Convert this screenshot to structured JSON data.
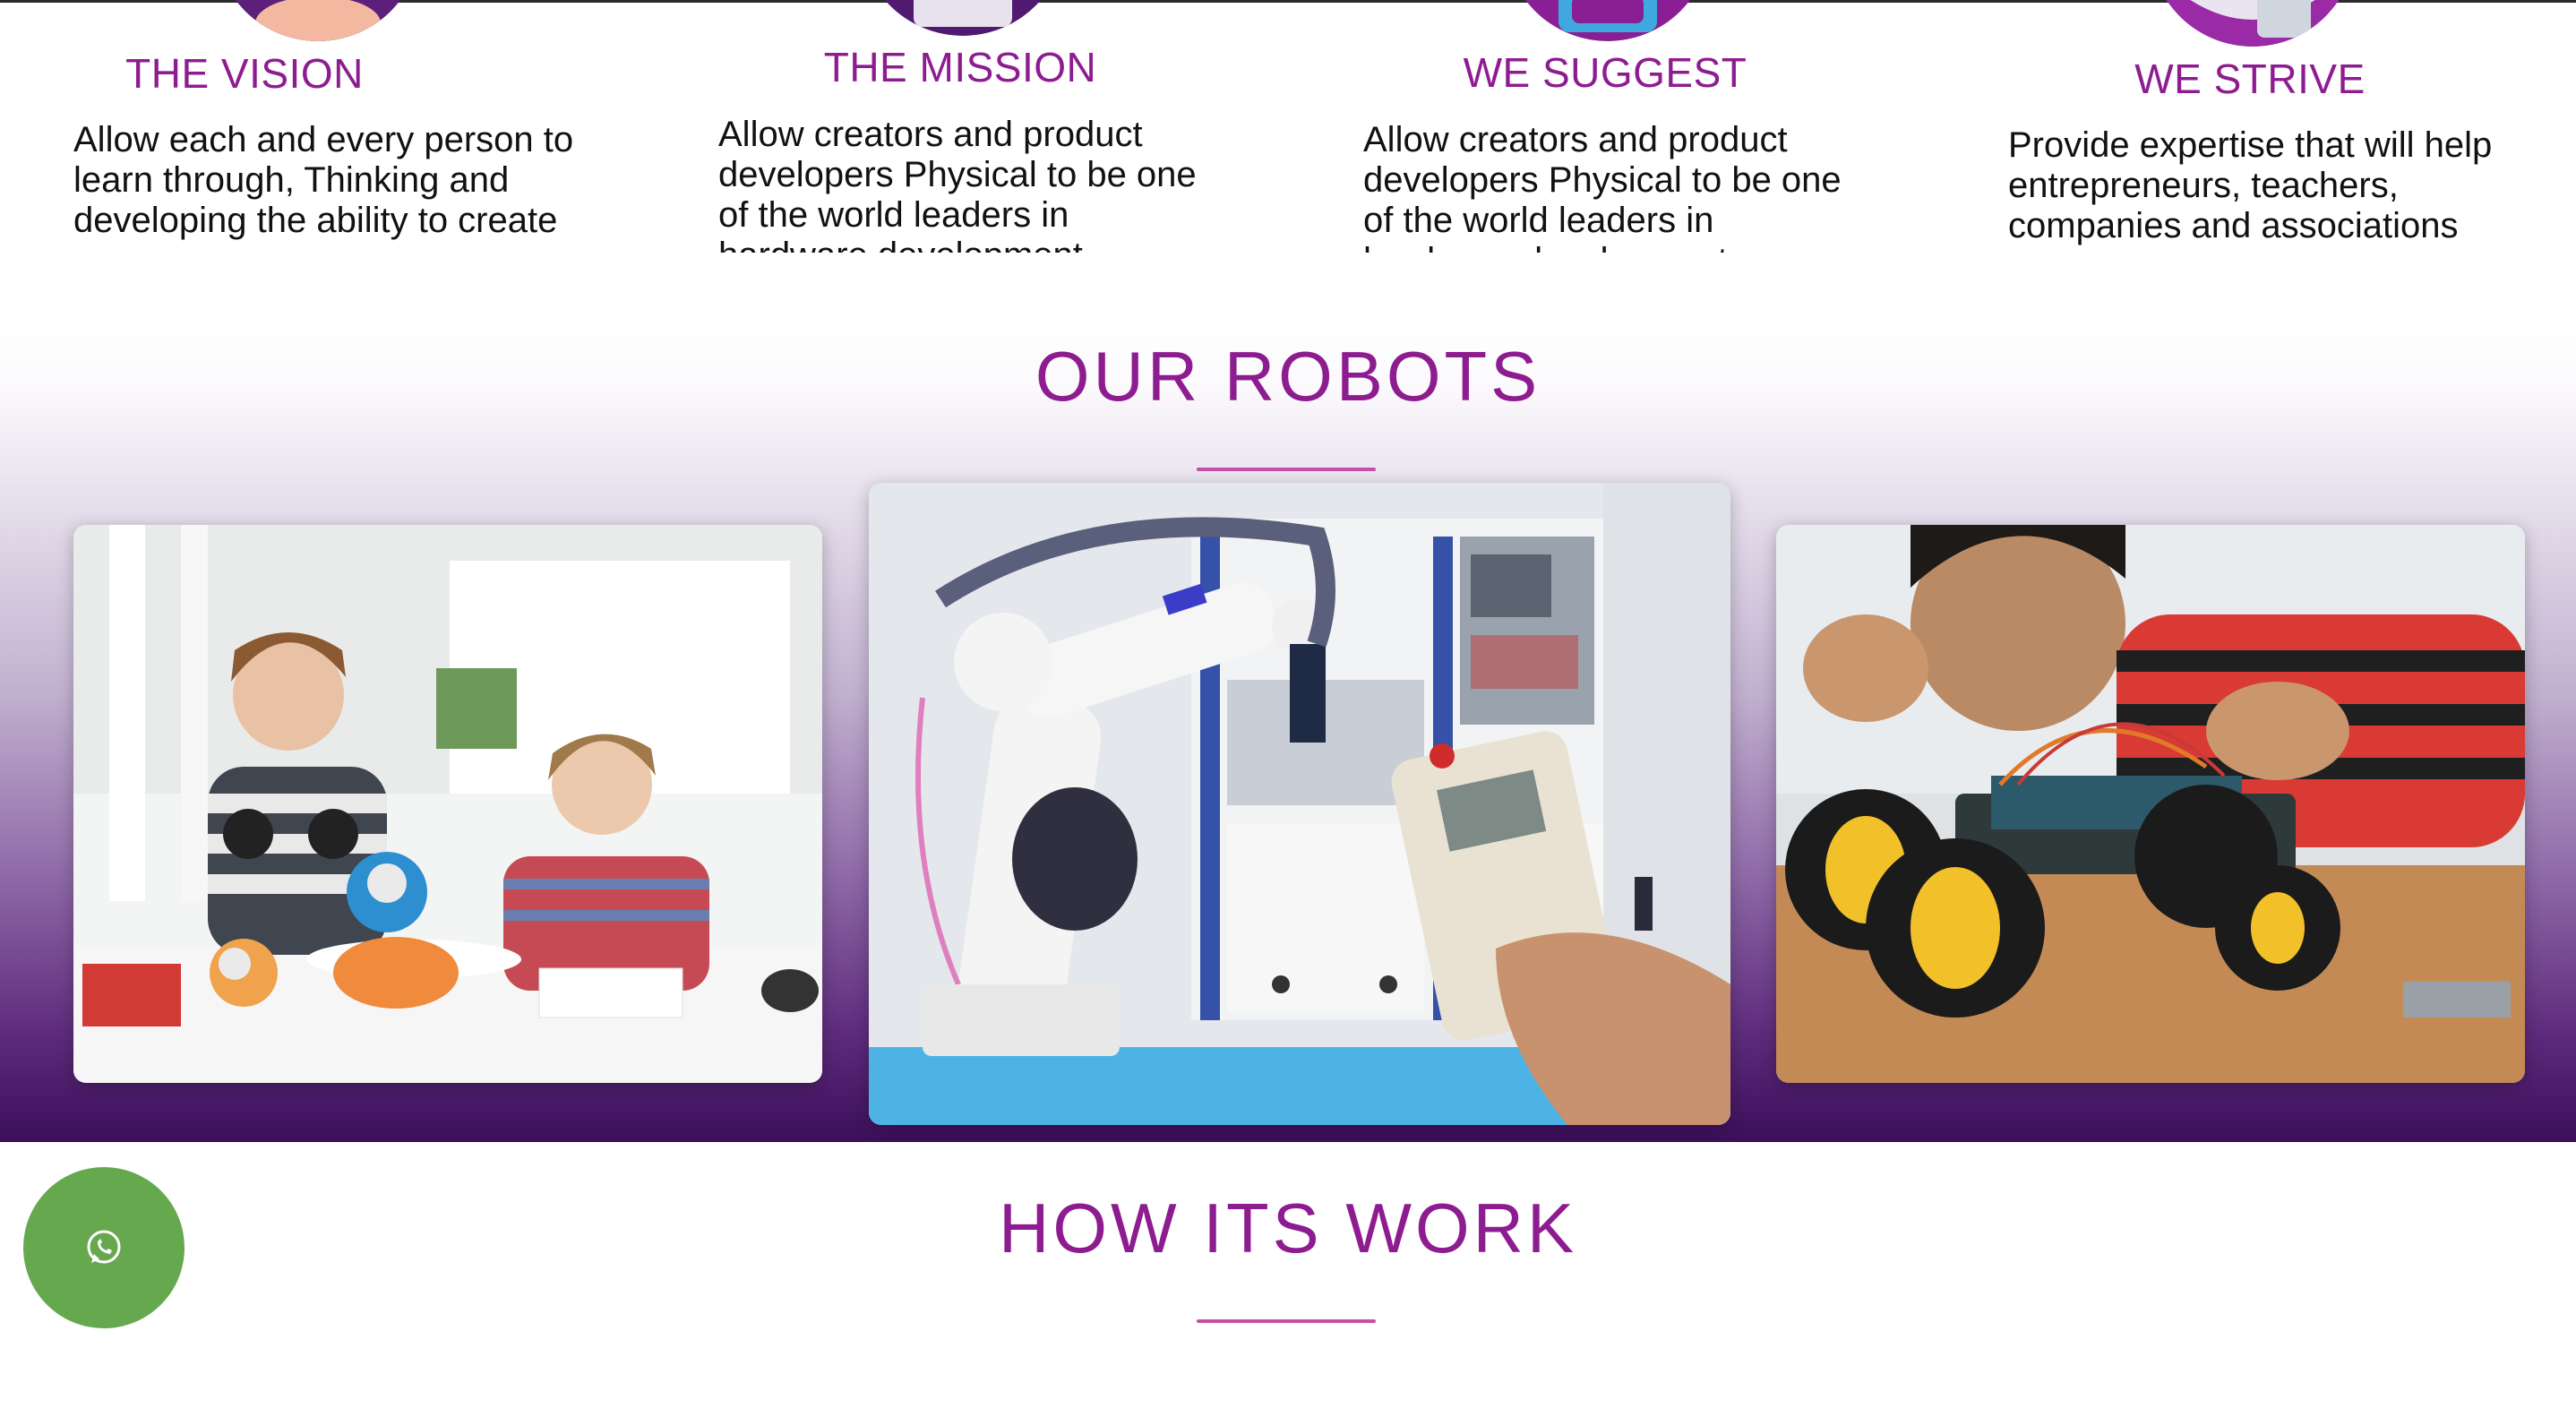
{
  "features": [
    {
      "title": "THE VISION",
      "text": "Allow each and every person to learn through, Thinking and developing the ability to create new realities",
      "icon": "vision-illustration-icon"
    },
    {
      "title": "THE MISSION",
      "text": "Allow creators and product developers Physical to be one of the world leaders in hardware development",
      "icon": "mission-illustration-icon"
    },
    {
      "title": "WE SUGGEST",
      "text": "Allow creators and product developers Physical to be one of the world leaders in hardware development",
      "icon": "suggest-illustration-icon"
    },
    {
      "title": "WE STRIVE",
      "text": "Provide expertise that will help entrepreneurs, teachers, companies and associations",
      "icon": "strive-illustration-icon"
    }
  ],
  "robots_section": {
    "title": "OUR ROBOTS",
    "images": [
      "kids-with-educational-robots-photo",
      "industrial-robot-arm-photo",
      "child-building-robot-car-photo"
    ]
  },
  "how_section": {
    "title": "HOW ITS WORK"
  },
  "whatsapp": {
    "icon": "whatsapp-icon",
    "color": "#66a84e"
  },
  "colors": {
    "accent": "#8e1c91",
    "rule": "#c64fa7",
    "gradient_bottom": "#3b0f5a"
  }
}
